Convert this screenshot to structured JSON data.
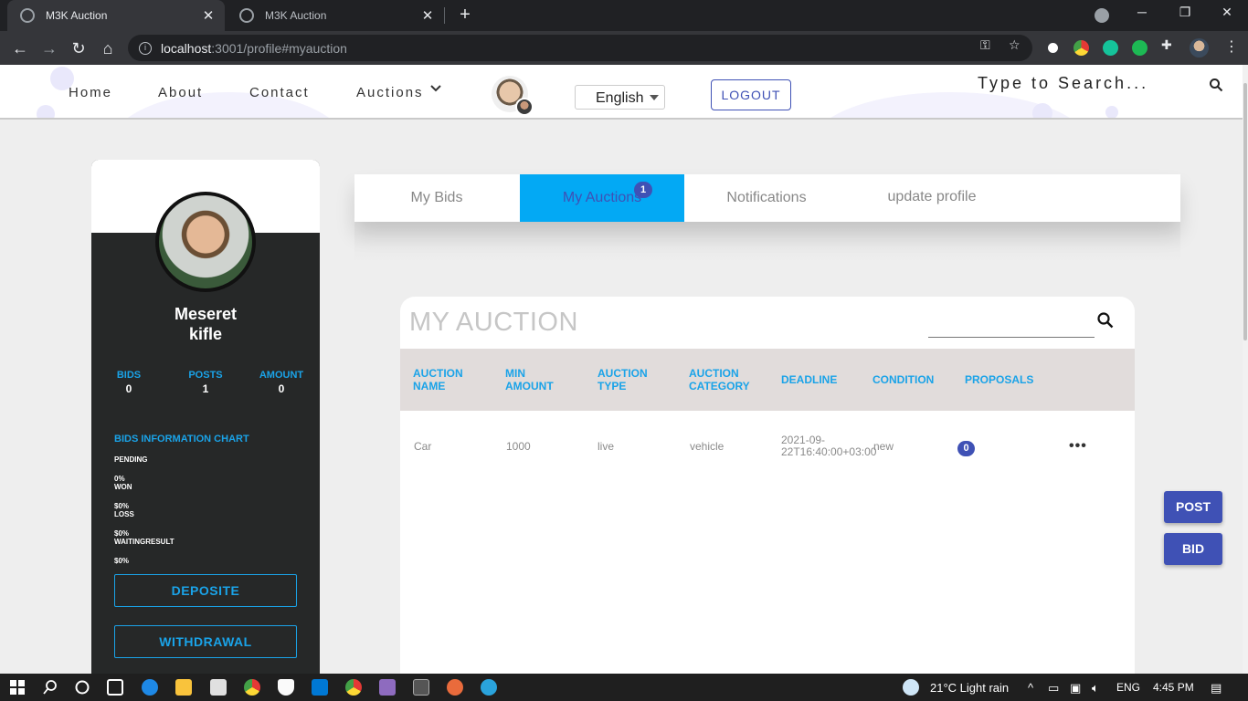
{
  "browser": {
    "tabs": [
      {
        "title": "M3K Auction",
        "active": true
      },
      {
        "title": "M3K Auction",
        "active": false
      }
    ],
    "url_host": "localhost",
    "url_rest": ":3001/profile#myauction"
  },
  "navbar": {
    "links": [
      "Home",
      "About",
      "Contact",
      "Auctions"
    ],
    "language": "English",
    "logout_label": "LOGOUT",
    "search_placeholder": "Type to Search..."
  },
  "profile": {
    "first_name": "Meseret",
    "last_name": "kifle",
    "stats": [
      {
        "label": "BIDS",
        "value": "0"
      },
      {
        "label": "POSTS",
        "value": "1"
      },
      {
        "label": "AMOUNT",
        "value": "0"
      }
    ],
    "chart_title": "BIDS INFORMATION CHART",
    "chart_items": [
      "PENDING",
      "0%",
      "WON",
      "$0%",
      "LOSS",
      "$0%",
      "WAITINGRESULT",
      "$0%"
    ],
    "deposit_label": "DEPOSITE",
    "withdrawal_label": "WITHDRAWAL"
  },
  "profile_tabs": {
    "items": [
      "My Bids",
      "My Auctions",
      "Notifications",
      "update profile"
    ],
    "active": "My Auctions",
    "badge": "1"
  },
  "auction_table": {
    "title": "MY AUCTION",
    "headers": [
      [
        "AUCTION",
        "NAME"
      ],
      [
        "MIN",
        "AMOUNT"
      ],
      [
        "AUCTION",
        "TYPE"
      ],
      [
        "AUCTION",
        "CATEGORY"
      ],
      [
        "DEADLINE"
      ],
      [
        "CONDITION"
      ],
      [
        "PROPOSALS"
      ]
    ],
    "rows": [
      {
        "name": "Car",
        "min_amount": "1000",
        "type": "live",
        "category": "vehicle",
        "deadline_line1": "2021-09-",
        "deadline_line2": "22T16:40:00+03:00",
        "condition": "new",
        "proposals": "0",
        "menu": "•••"
      }
    ]
  },
  "floating_buttons": {
    "post_label": "POST",
    "bid_label": "BID"
  },
  "taskbar": {
    "weather": "21°C  Light rain",
    "language": "ENG",
    "time": "4:45 PM"
  },
  "colors": {
    "accent_blue": "#03a9f4",
    "primary_indigo": "#3f51b5",
    "label_blue": "#1aa3e8",
    "card_dark": "#262828"
  }
}
